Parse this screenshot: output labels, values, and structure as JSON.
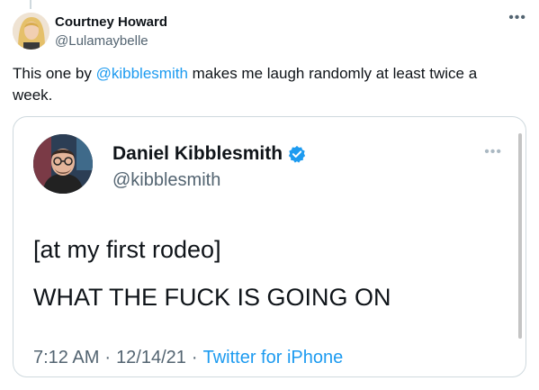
{
  "outer_tweet": {
    "display_name": "Courtney Howard",
    "handle": "@Lulamaybelle",
    "more_icon": "ellipsis-icon",
    "text_before": "This one by ",
    "mention": "@kibblesmith",
    "text_after": " makes me laugh randomly at least twice a week."
  },
  "quoted_tweet": {
    "display_name": "Daniel Kibblesmith",
    "verified_icon": "verified-badge-icon",
    "handle": "@kibblesmith",
    "more_icon": "ellipsis-icon",
    "line1": "[at my first rodeo]",
    "line2": "WHAT THE FUCK IS GOING ON",
    "time": "7:12 AM",
    "date": "12/14/21",
    "separator": "·",
    "source": "Twitter for iPhone"
  },
  "colors": {
    "link": "#1d9bf0",
    "secondary_text": "#536471",
    "border": "#cfd9de",
    "verified": "#1d9bf0"
  }
}
